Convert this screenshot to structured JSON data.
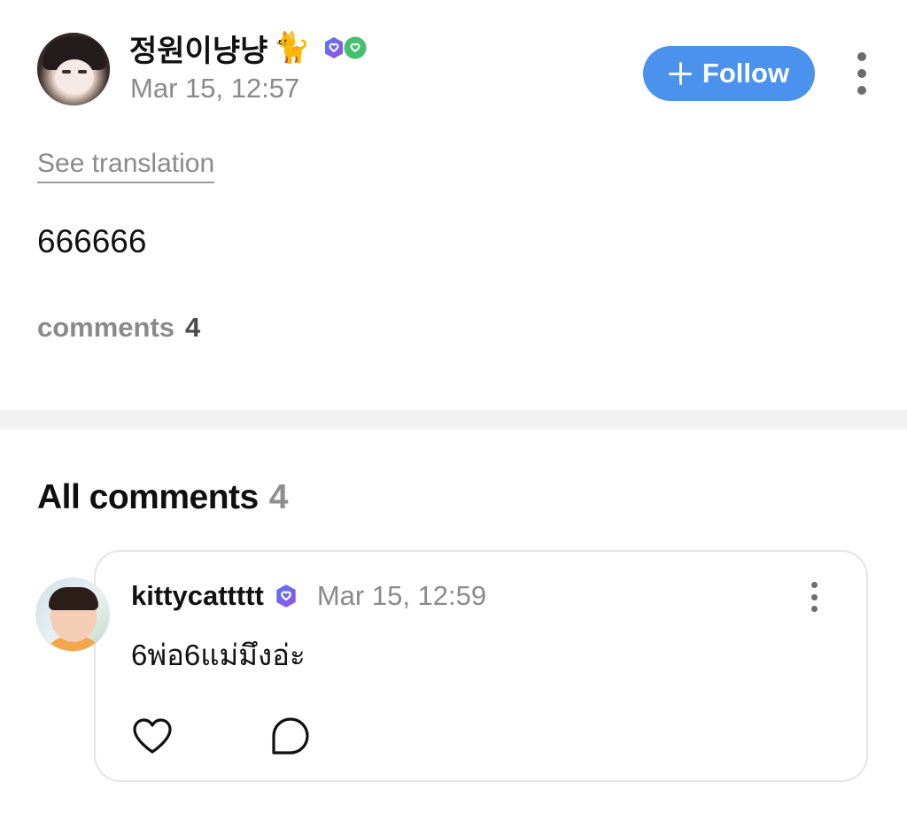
{
  "post": {
    "author": {
      "name": "정원이냥냥",
      "emoji": "🐈",
      "badges": [
        "verified-shield-icon",
        "verified-heart-icon"
      ]
    },
    "timestamp": "Mar 15, 12:57",
    "follow_label": "Follow",
    "see_translation_label": "See translation",
    "body": "666666",
    "comments_label": "comments",
    "comments_count": "4"
  },
  "comments_section": {
    "title": "All comments",
    "count": "4",
    "items": [
      {
        "author": "kittycattttt",
        "timestamp": "Mar 15, 12:59",
        "text": "6พ่อ6แม่มึงอ่ะ"
      }
    ]
  },
  "colors": {
    "accent": "#4a92ee",
    "muted_text": "#8a8a8a",
    "badge_purple": "#6b5ce7",
    "badge_green": "#43c06a"
  }
}
